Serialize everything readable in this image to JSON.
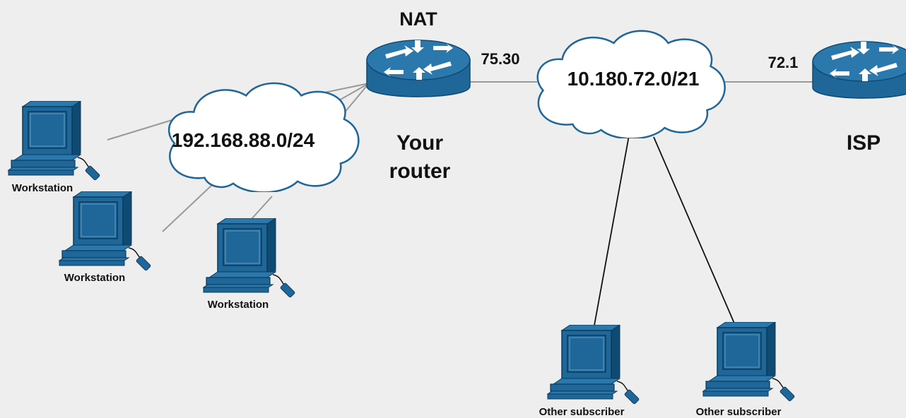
{
  "local_network": {
    "cidr": "192.168.88.0/24",
    "workstations": [
      {
        "label": "Workstation"
      },
      {
        "label": "Workstation"
      },
      {
        "label": "Workstation"
      }
    ]
  },
  "router": {
    "top_label": "NAT",
    "name_line1": "Your",
    "name_line2": "router",
    "wan_address": "75.30"
  },
  "isp_network": {
    "cidr": "10.180.72.0/21",
    "subscribers": [
      {
        "label": "Other subscriber"
      },
      {
        "label": "Other subscriber"
      }
    ]
  },
  "isp": {
    "address": "72.1",
    "name": "ISP"
  },
  "colors": {
    "device": "#1f6699",
    "device_dark": "#0f4a73",
    "background": "#eeeeee",
    "link_light": "#999999",
    "link_dark": "#111111"
  }
}
